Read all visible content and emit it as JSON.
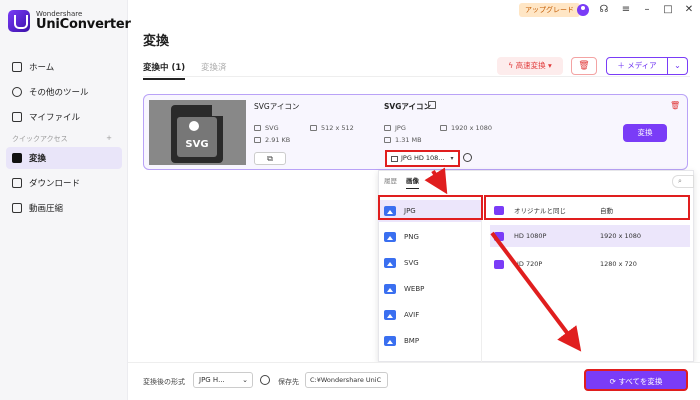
{
  "app": {
    "brand_small": "Wondershare",
    "brand_big": "UniConverter",
    "upgrade_label": "アップグレード"
  },
  "sidebar": {
    "items": [
      {
        "label": "ホーム",
        "icon": "home-icon"
      },
      {
        "label": "その他のツール",
        "icon": "tools-icon"
      },
      {
        "label": "マイファイル",
        "icon": "file-icon"
      }
    ],
    "quick_access_label": "クイックアクセス",
    "quick_access_add": "+",
    "quick_items": [
      {
        "label": "変換",
        "icon": "convert-icon",
        "active": true
      },
      {
        "label": "ダウンロード",
        "icon": "download-icon"
      },
      {
        "label": "動画圧縮",
        "icon": "compress-icon"
      }
    ]
  },
  "header": {
    "title": "変換",
    "tab_converting": "変換中 (1)",
    "tab_converted": "変換済",
    "fast_convert_label": "高速変換",
    "media_label": "メディア"
  },
  "file_card": {
    "source_name": "SVGアイコン",
    "thumb_text": "SVG",
    "source_format": "SVG",
    "source_size": "2.91 KB",
    "source_resolution": "512 x 512",
    "output_name": "SVGアイコン",
    "output_format": "JPG",
    "output_size": "1.31 MB",
    "output_resolution": "1920 x 1080",
    "convert_label": "変換",
    "format_select_value": "JPG HD 108..."
  },
  "panel": {
    "tab_history": "履歴",
    "tab_image": "画像",
    "formats": [
      {
        "label": "JPG",
        "selected": true
      },
      {
        "label": "PNG"
      },
      {
        "label": "SVG"
      },
      {
        "label": "WEBP"
      },
      {
        "label": "AVIF"
      },
      {
        "label": "BMP"
      }
    ],
    "qualities": [
      {
        "label": "オリジナルと同じ",
        "value": "自動"
      },
      {
        "label": "HD 1080P",
        "value": "1920 x 1080"
      },
      {
        "label": "HD 720P",
        "value": "1280 x 720"
      }
    ]
  },
  "bottom": {
    "output_format_label": "変換後の形式",
    "output_format_value": "JPG H...",
    "save_to_label": "保存先",
    "save_path": "C:¥Wondershare UniC",
    "convert_all_label": "すべてを変換"
  },
  "colors": {
    "accent": "#7a3cf7",
    "highlight_red": "#e01e1e",
    "danger": "#e03a3a"
  }
}
